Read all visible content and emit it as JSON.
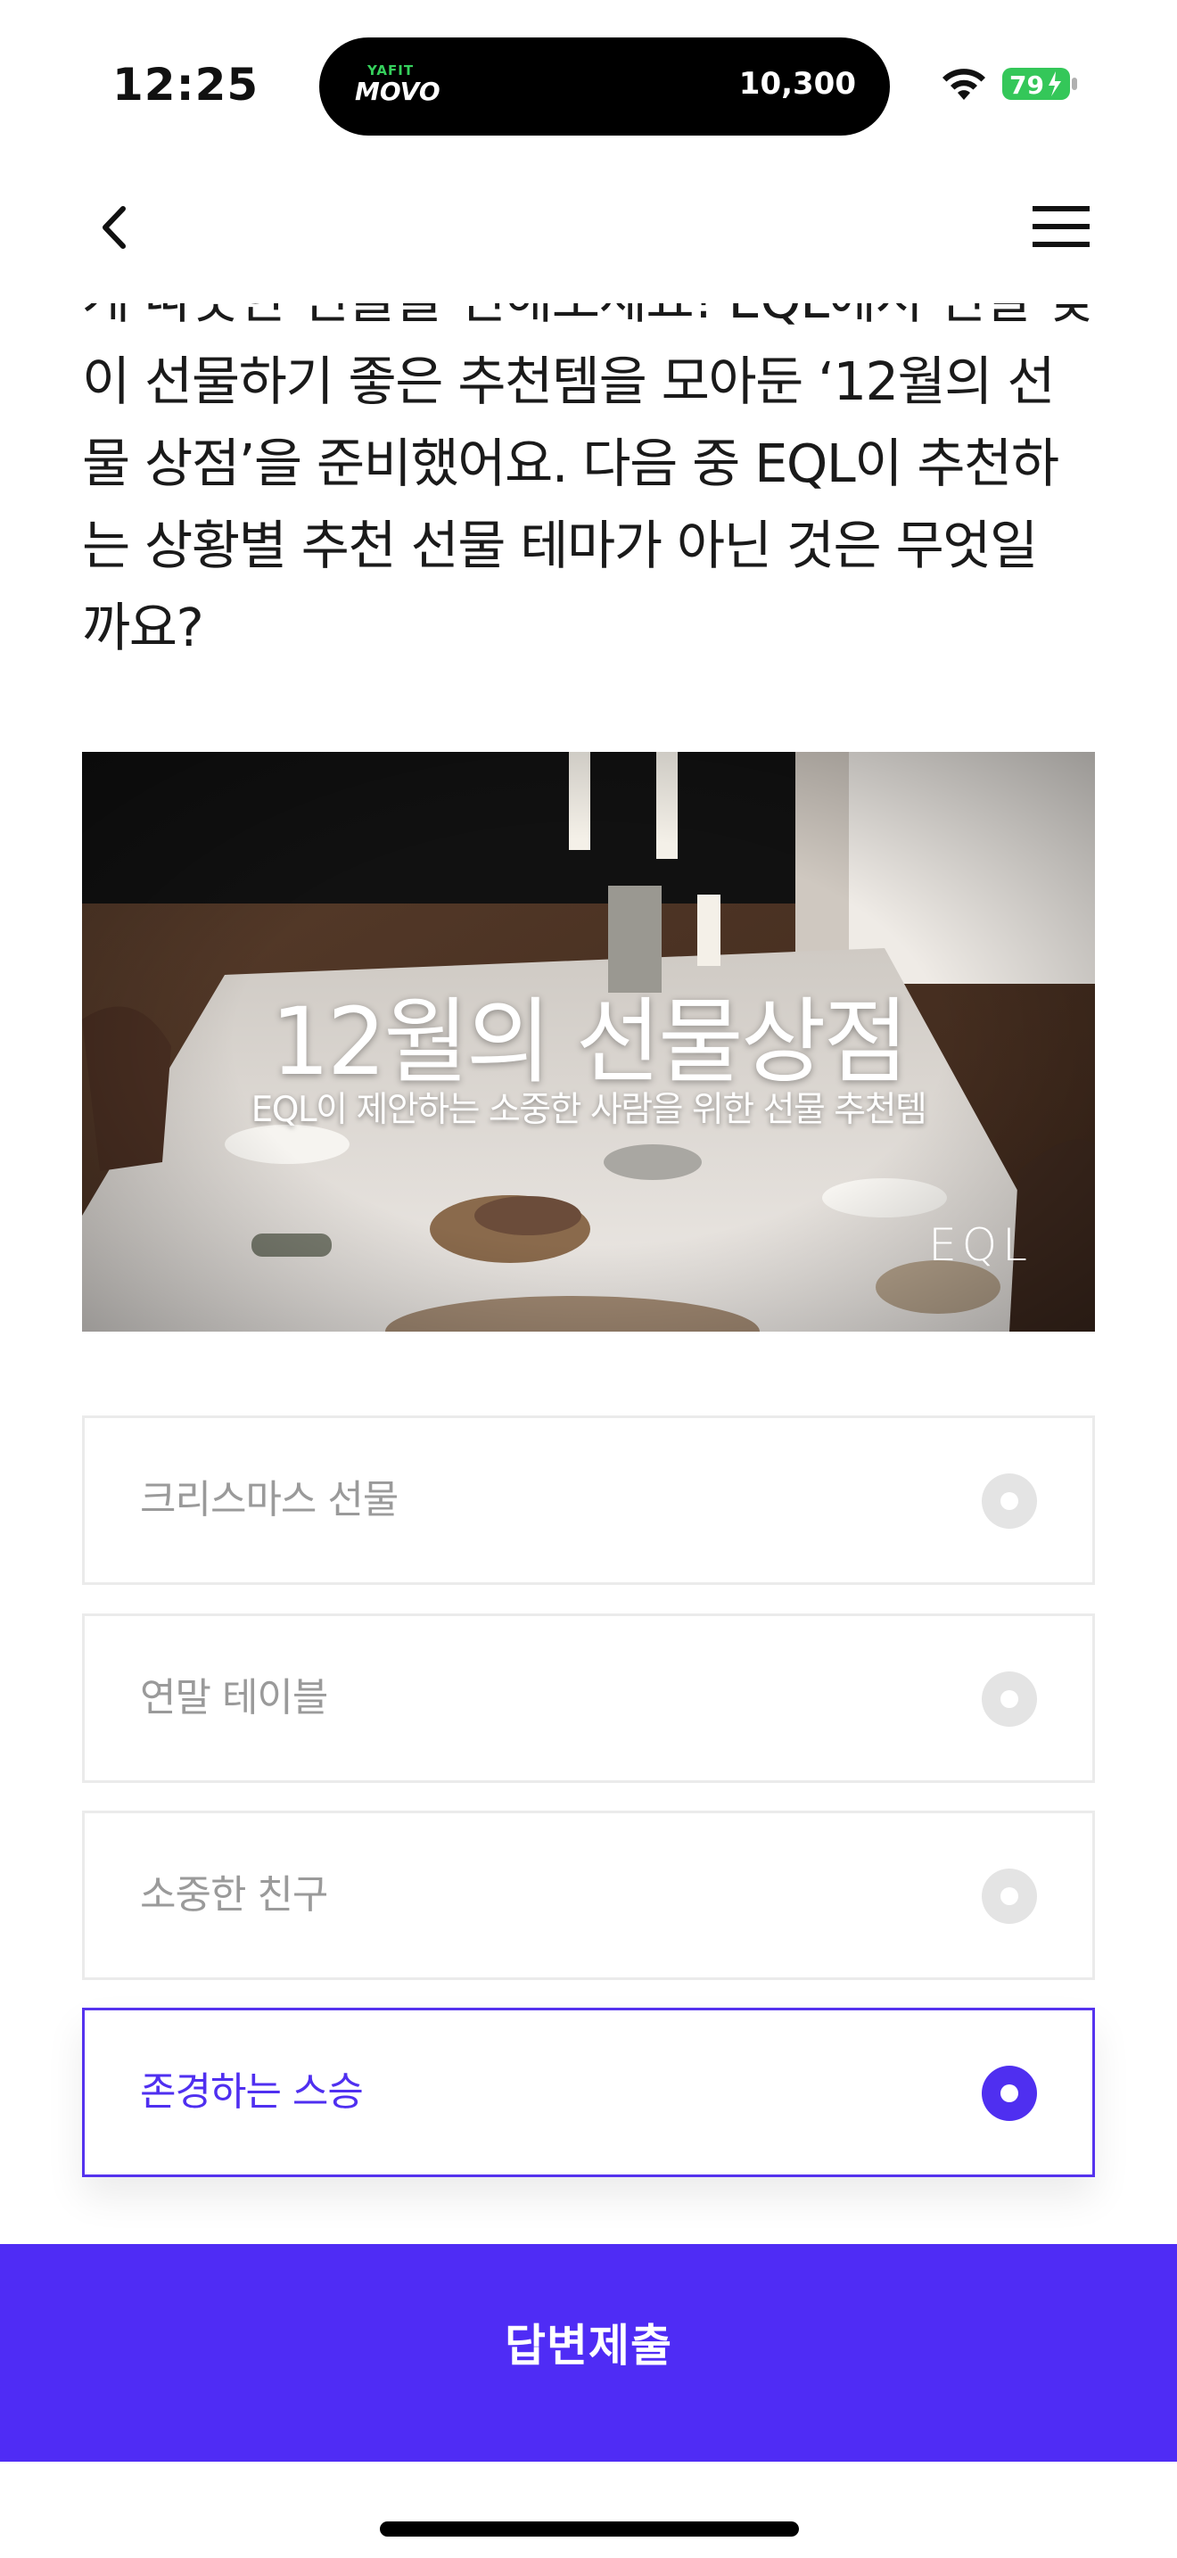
{
  "status_bar": {
    "time": "12:25",
    "activity_brand_small": "YAFIT",
    "activity_brand": "MOVO",
    "activity_value": "10,300",
    "battery_percent": "79",
    "battery_color": "#34c759"
  },
  "icons": {
    "back": "chevron-left-icon",
    "menu": "hamburger-menu-icon",
    "wifi": "wifi-icon",
    "battery": "battery-charging-icon",
    "radio": "radio-button-icon"
  },
  "quiz": {
    "question_lines": [
      "게 따뜻한 선물을 전해보세요! EQL에서 연말 맞",
      "이 선물하기 좋은 추천템을 모아둔 ‘12월의 선",
      "물 상점’을 준비했어요. 다음 중 EQL이 추천하",
      "는 상황별 추천 선물 테마가 아닌 것은 무엇일",
      "까요?"
    ],
    "banner": {
      "title": "12월의 선물상점",
      "subtitle": "EQL이 제안하는 소중한 사람을 위한 선물 추천템",
      "logo": "EQL"
    },
    "options": [
      {
        "label": "크리스마스 선물",
        "selected": false
      },
      {
        "label": "연말 테이블",
        "selected": false
      },
      {
        "label": "소중한 친구",
        "selected": false
      },
      {
        "label": "존경하는 스승",
        "selected": true
      }
    ],
    "submit_label": "답변제출"
  },
  "colors": {
    "accent": "#4f2cf5",
    "selected_border": "#5533ee",
    "unselected_text": "#9a9a9a",
    "radio_unselected": "#e4e4e4"
  }
}
